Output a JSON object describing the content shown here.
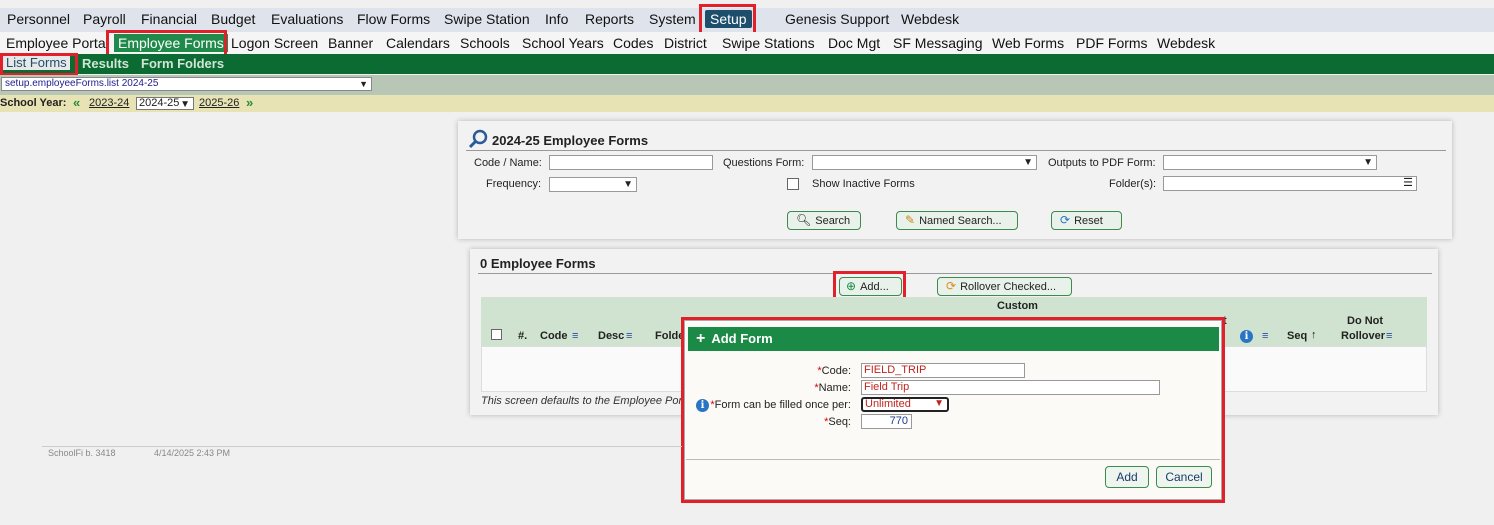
{
  "top_menu": [
    "Personnel",
    "Payroll",
    "Financial",
    "Budget",
    "Evaluations",
    "Flow Forms",
    "Swipe Station",
    "Info",
    "Reports",
    "System",
    "Setup",
    "Genesis Support",
    "Webdesk"
  ],
  "sub_menu": [
    "Employee Portal",
    "Employee Forms",
    "Logon Screen",
    "Banner",
    "Calendars",
    "Schools",
    "School Years",
    "Codes",
    "District",
    "Swipe Stations",
    "Doc Mgt",
    "SF Messaging",
    "Web Forms",
    "PDF Forms",
    "Webdesk"
  ],
  "tabs": [
    "List Forms",
    "Results",
    "Form Folders"
  ],
  "path_select": "setup.employeeForms.list 2024-25",
  "school_year": {
    "label": "School Year:",
    "prev": "2023-24",
    "current": "2024-25",
    "next": "2025-26"
  },
  "search_panel": {
    "title": "2024-25 Employee Forms",
    "code_name_label": "Code / Name:",
    "questions_label": "Questions Form:",
    "outputs_label": "Outputs to PDF Form:",
    "frequency_label": "Frequency:",
    "show_inactive_label": "Show Inactive Forms",
    "folders_label": "Folder(s):",
    "search_btn": "Search",
    "named_search_btn": "Named Search...",
    "reset_btn": "Reset"
  },
  "results_panel": {
    "title": "0 Employee Forms",
    "add_btn": "Add...",
    "rollover_btn": "Rollover Checked...",
    "custom_header": "Custom",
    "col_num": "#.",
    "col_code": "Code",
    "col_desc": "Desc",
    "col_folder": "Folde",
    "col_t": "t",
    "col_seq": "Seq",
    "col_do_not": "Do Not",
    "col_rollover": "Rollover",
    "note": "This screen defaults to the Employee Port"
  },
  "dialog": {
    "title": "Add Form",
    "code_label": "Code:",
    "code_value": "FIELD_TRIP",
    "name_label": "Name:",
    "name_value": "Field Trip",
    "filled_label": "Form can be filled once per:",
    "filled_value": "Unlimited",
    "seq_label": "Seq:",
    "seq_value": "770",
    "add_btn": "Add",
    "cancel_btn": "Cancel"
  },
  "footer": {
    "build": "SchoolFi b. 3418",
    "datetime": "4/14/2025 2:43 PM"
  },
  "colors": {
    "green_bar": "#0c6b32",
    "dialog_header": "#1a8a46",
    "highlight": "#e0202a",
    "setup_active": "#1d4f6c"
  }
}
